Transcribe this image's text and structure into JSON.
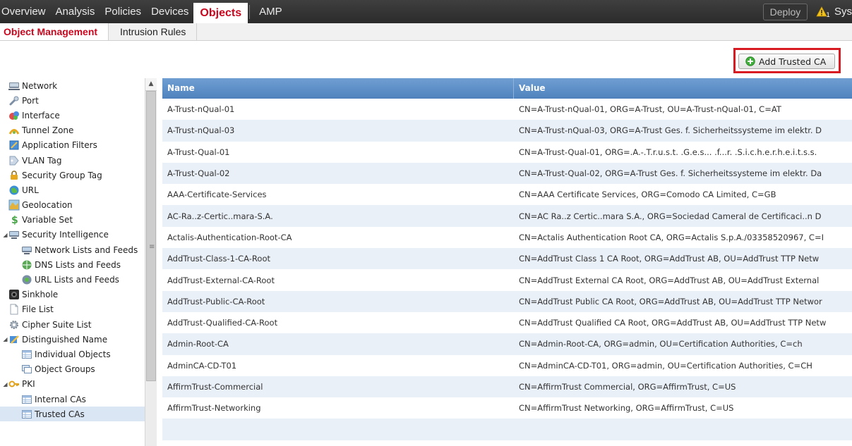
{
  "topnav": {
    "items": [
      "Overview",
      "Analysis",
      "Policies",
      "Devices",
      "Objects",
      "AMP"
    ],
    "active_index": 4,
    "deploy_label": "Deploy",
    "alert_count": "1",
    "system_label": "Sys"
  },
  "subnav": {
    "tabs": [
      "Object Management",
      "Intrusion Rules"
    ],
    "active_index": 0
  },
  "actions": {
    "add_trusted_ca_label": "Add Trusted CA"
  },
  "sidebar": {
    "items": [
      {
        "label": "Network",
        "icon": "network-icon",
        "level": 0
      },
      {
        "label": "Port",
        "icon": "port-icon",
        "level": 0
      },
      {
        "label": "Interface",
        "icon": "interface-icon",
        "level": 0
      },
      {
        "label": "Tunnel Zone",
        "icon": "tunnel-zone-icon",
        "level": 0
      },
      {
        "label": "Application Filters",
        "icon": "application-filters-icon",
        "level": 0
      },
      {
        "label": "VLAN Tag",
        "icon": "tag-icon",
        "level": 0
      },
      {
        "label": "Security Group Tag",
        "icon": "security-group-tag-icon",
        "level": 0
      },
      {
        "label": "URL",
        "icon": "globe-icon",
        "level": 0
      },
      {
        "label": "Geolocation",
        "icon": "geolocation-icon",
        "level": 0
      },
      {
        "label": "Variable Set",
        "icon": "dollar-icon",
        "level": 0
      },
      {
        "label": "Security Intelligence",
        "icon": "security-intelligence-icon",
        "level": 0,
        "expanded": true
      },
      {
        "label": "Network Lists and Feeds",
        "icon": "network-lists-icon",
        "level": 1
      },
      {
        "label": "DNS Lists and Feeds",
        "icon": "dns-lists-icon",
        "level": 1
      },
      {
        "label": "URL Lists and Feeds",
        "icon": "url-lists-icon",
        "level": 1
      },
      {
        "label": "Sinkhole",
        "icon": "sinkhole-icon",
        "level": 0
      },
      {
        "label": "File List",
        "icon": "file-list-icon",
        "level": 0
      },
      {
        "label": "Cipher Suite List",
        "icon": "cipher-suite-icon",
        "level": 0
      },
      {
        "label": "Distinguished Name",
        "icon": "distinguished-name-icon",
        "level": 0,
        "expanded": true
      },
      {
        "label": "Individual Objects",
        "icon": "table-icon",
        "level": 1
      },
      {
        "label": "Object Groups",
        "icon": "object-groups-icon",
        "level": 1
      },
      {
        "label": "PKI",
        "icon": "key-icon",
        "level": 0,
        "expanded": true
      },
      {
        "label": "Internal CAs",
        "icon": "table-icon",
        "level": 1
      },
      {
        "label": "Trusted CAs",
        "icon": "table-icon",
        "level": 1,
        "selected": true
      }
    ]
  },
  "table": {
    "columns": [
      "Name",
      "Value"
    ],
    "rows": [
      {
        "name": "A-Trust-nQual-01",
        "value": "CN=A-Trust-nQual-01, ORG=A-Trust, OU=A-Trust-nQual-01, C=AT"
      },
      {
        "name": "A-Trust-nQual-03",
        "value": "CN=A-Trust-nQual-03, ORG=A-Trust Ges. f. Sicherheitssysteme im elektr. D"
      },
      {
        "name": "A-Trust-Qual-01",
        "value": "CN=A-Trust-Qual-01, ORG=.A.-.T.r.u.s.t. .G.e.s... .f...r. .S.i.c.h.e.r.h.e.i.t.s.s."
      },
      {
        "name": "A-Trust-Qual-02",
        "value": "CN=A-Trust-Qual-02, ORG=A-Trust Ges. f. Sicherheitssysteme im elektr. Da"
      },
      {
        "name": "AAA-Certificate-Services",
        "value": "CN=AAA Certificate Services, ORG=Comodo CA Limited, C=GB"
      },
      {
        "name": "AC-Ra..z-Certic..mara-S.A.",
        "value": "CN=AC Ra..z Certic..mara S.A., ORG=Sociedad Cameral de Certificaci..n D"
      },
      {
        "name": "Actalis-Authentication-Root-CA",
        "value": "CN=Actalis Authentication Root CA, ORG=Actalis S.p.A./03358520967, C=I"
      },
      {
        "name": "AddTrust-Class-1-CA-Root",
        "value": "CN=AddTrust Class 1 CA Root, ORG=AddTrust AB, OU=AddTrust TTP Netw"
      },
      {
        "name": "AddTrust-External-CA-Root",
        "value": "CN=AddTrust External CA Root, ORG=AddTrust AB, OU=AddTrust External"
      },
      {
        "name": "AddTrust-Public-CA-Root",
        "value": "CN=AddTrust Public CA Root, ORG=AddTrust AB, OU=AddTrust TTP Networ"
      },
      {
        "name": "AddTrust-Qualified-CA-Root",
        "value": "CN=AddTrust Qualified CA Root, ORG=AddTrust AB, OU=AddTrust TTP Netw"
      },
      {
        "name": "Admin-Root-CA",
        "value": "CN=Admin-Root-CA, ORG=admin, OU=Certification Authorities, C=ch"
      },
      {
        "name": "AdminCA-CD-T01",
        "value": "CN=AdminCA-CD-T01, ORG=admin, OU=Certification Authorities, C=CH"
      },
      {
        "name": "AffirmTrust-Commercial",
        "value": "CN=AffirmTrust Commercial, ORG=AffirmTrust, C=US"
      },
      {
        "name": "AffirmTrust-Networking",
        "value": "CN=AffirmTrust Networking, ORG=AffirmTrust, C=US"
      },
      {
        "name": "",
        "value": ""
      }
    ]
  },
  "colors": {
    "brand_red": "#c9071e",
    "header_blue": "#5a8cc6",
    "row_alt": "#eaf0f8",
    "highlight_red": "#d81a22",
    "topbar": "#333333"
  }
}
